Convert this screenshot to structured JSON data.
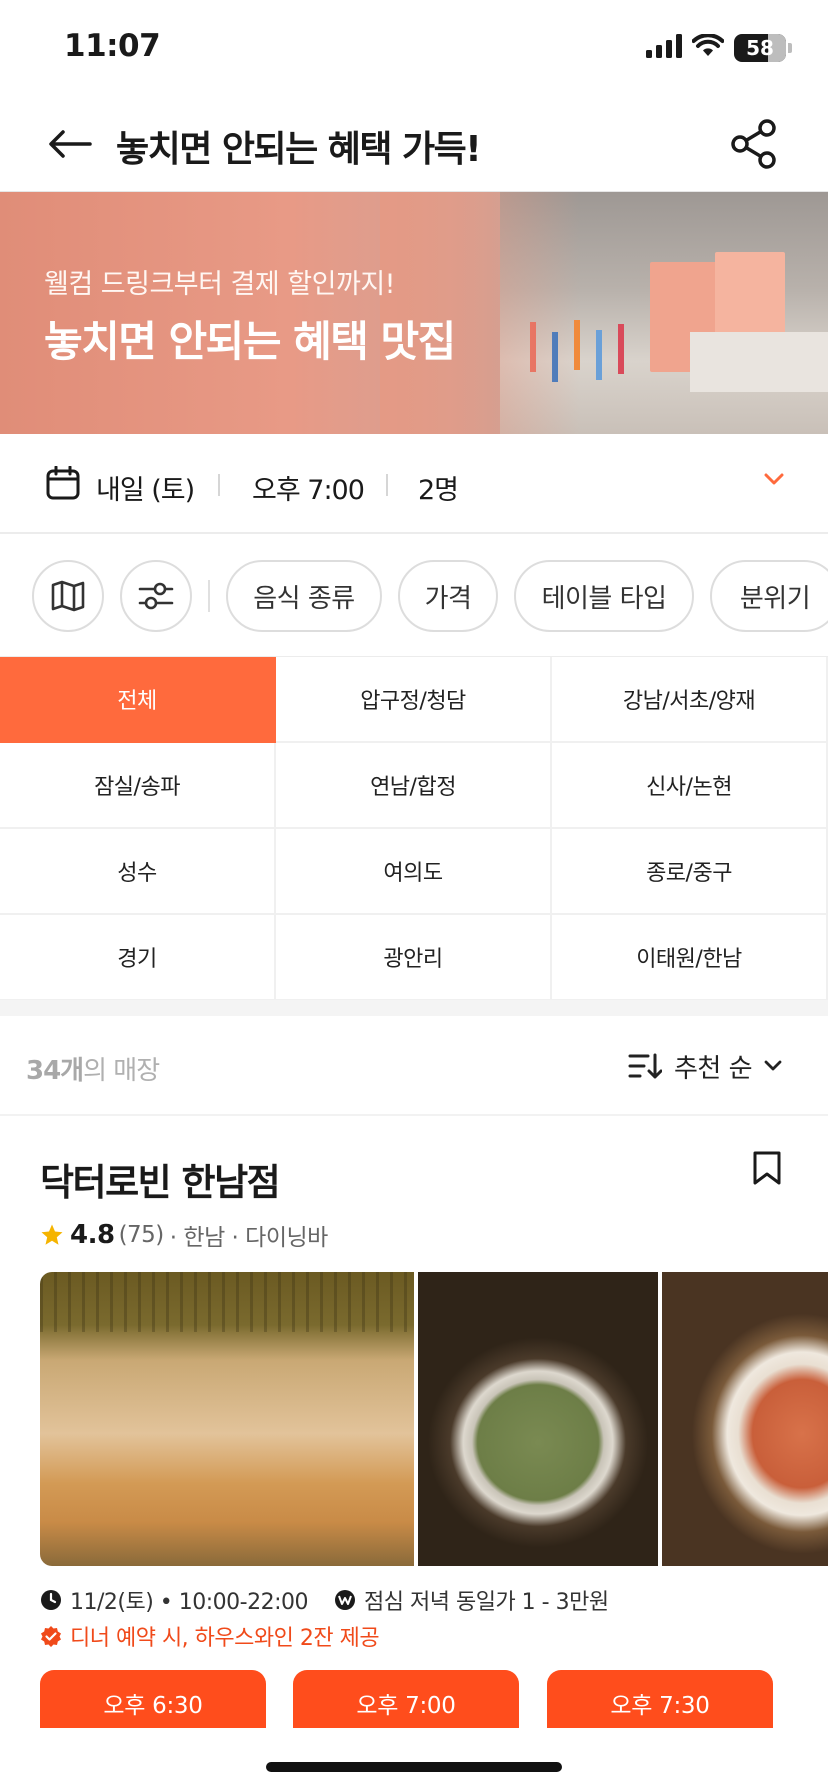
{
  "status_bar": {
    "time": "11:07",
    "battery": "58"
  },
  "header": {
    "title": "놓치면 안되는 혜택 가득!"
  },
  "banner": {
    "subtitle": "웰컴 드링크부터 결제 할인까지!",
    "title": "놓치면 안되는 혜택 맛집"
  },
  "booking": {
    "date": "내일 (토)",
    "time": "오후 7:00",
    "party_size": "2명"
  },
  "filters": {
    "chips": [
      "음식 종류",
      "가격",
      "테이블 타입",
      "분위기"
    ]
  },
  "regions": [
    "전체",
    "압구정/청담",
    "강남/서초/양재",
    "잠실/송파",
    "연남/합정",
    "신사/논현",
    "성수",
    "여의도",
    "종로/중구",
    "경기",
    "광안리",
    "이태원/한남"
  ],
  "list_header": {
    "count": "34개",
    "count_suffix": "의 매장",
    "sort_label": "추천 순"
  },
  "restaurant": {
    "name": "닥터로빈 한남점",
    "rating": "4.8",
    "reviews": "(75)",
    "meta": "· 한남 · 다이닝바",
    "hours": "11/2(토) • 10:00-22:00",
    "price": "점심 저녁 동일가 1 - 3만원",
    "benefit": "디너 예약 시, 하우스와인 2잔 제공",
    "time_slots": [
      "오후 6:30",
      "오후 7:00",
      "오후 7:30"
    ]
  },
  "colors": {
    "accent": "#ff6a3d",
    "slot_button": "#ff4d1c",
    "benefit_text": "#f04a1a",
    "star": "#f5b400"
  }
}
